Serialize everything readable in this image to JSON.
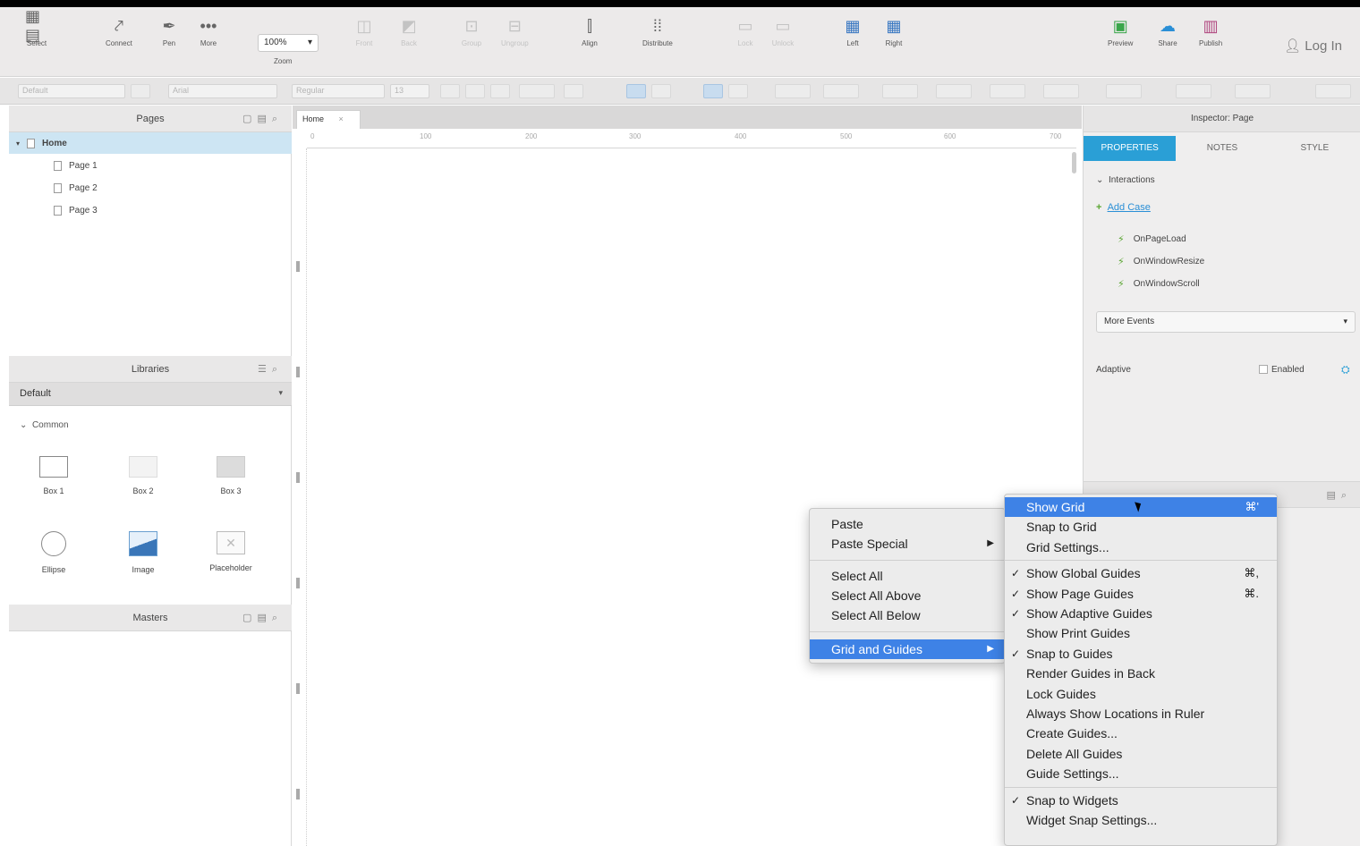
{
  "toolbar": {
    "select_label": "Select",
    "connect_label": "Connect",
    "pen_label": "Pen",
    "more_label": "More",
    "zoom_value": "100%",
    "zoom_label": "Zoom",
    "front_label": "Front",
    "back_label": "Back",
    "group_label": "Group",
    "ungroup_label": "Ungroup",
    "align_label": "Align",
    "distribute_label": "Distribute",
    "lock_label": "Lock",
    "unlock_label": "Unlock",
    "left_label": "Left",
    "right_label": "Right",
    "preview_label": "Preview",
    "share_label": "Share",
    "publish_label": "Publish",
    "login_label": "Log In"
  },
  "format_bar": {
    "style_value": "Default",
    "font_value": "Arial",
    "weight_value": "Regular",
    "size_value": "13"
  },
  "pages_panel": {
    "title": "Pages",
    "home": "Home",
    "items": [
      "Page 1",
      "Page 2",
      "Page 3"
    ]
  },
  "libraries_panel": {
    "title": "Libraries",
    "library": "Default",
    "group": "Common",
    "widgets": [
      "Box 1",
      "Box 2",
      "Box 3",
      "Ellipse",
      "Image",
      "Placeholder"
    ]
  },
  "masters_panel": {
    "title": "Masters"
  },
  "canvas": {
    "tab_label": "Home",
    "ruler_ticks": [
      "0",
      "100",
      "200",
      "300",
      "400",
      "500",
      "600",
      "700"
    ]
  },
  "inspector": {
    "title": "Inspector: Page",
    "tabs": [
      "PROPERTIES",
      "NOTES",
      "STYLE"
    ],
    "interactions_label": "Interactions",
    "add_case_label": "Add Case",
    "events": [
      "OnPageLoad",
      "OnWindowResize",
      "OnWindowScroll"
    ],
    "more_events_label": "More Events",
    "adaptive_label": "Adaptive",
    "enabled_label": "Enabled"
  },
  "context_menu": {
    "items": [
      "Paste",
      "Paste Special",
      "Select All",
      "Select All Above",
      "Select All Below",
      "Grid and Guides"
    ]
  },
  "submenu": {
    "items": [
      {
        "label": "Show Grid",
        "checked": false,
        "shortcut": "⌘'",
        "highlighted": true
      },
      {
        "label": "Snap to Grid",
        "checked": false,
        "shortcut": "",
        "highlighted": false
      },
      {
        "label": "Grid Settings...",
        "checked": false,
        "shortcut": "",
        "highlighted": false
      },
      {
        "label": "Show Global Guides",
        "checked": true,
        "shortcut": "⌘,",
        "highlighted": false
      },
      {
        "label": "Show Page Guides",
        "checked": true,
        "shortcut": "⌘.",
        "highlighted": false
      },
      {
        "label": "Show Adaptive Guides",
        "checked": true,
        "shortcut": "",
        "highlighted": false
      },
      {
        "label": "Show Print Guides",
        "checked": false,
        "shortcut": "",
        "highlighted": false
      },
      {
        "label": "Snap to Guides",
        "checked": true,
        "shortcut": "",
        "highlighted": false
      },
      {
        "label": "Render Guides in Back",
        "checked": false,
        "shortcut": "",
        "highlighted": false
      },
      {
        "label": "Lock Guides",
        "checked": false,
        "shortcut": "",
        "highlighted": false
      },
      {
        "label": "Always Show Locations in Ruler",
        "checked": false,
        "shortcut": "",
        "highlighted": false
      },
      {
        "label": "Create Guides...",
        "checked": false,
        "shortcut": "",
        "highlighted": false
      },
      {
        "label": "Delete All Guides",
        "checked": false,
        "shortcut": "",
        "highlighted": false
      },
      {
        "label": "Guide Settings...",
        "checked": false,
        "shortcut": "",
        "highlighted": false
      },
      {
        "label": "Snap to Widgets",
        "checked": true,
        "shortcut": "",
        "highlighted": false
      },
      {
        "label": "Widget Snap Settings...",
        "checked": false,
        "shortcut": "",
        "highlighted": false
      }
    ]
  },
  "colors": {
    "accent": "#2a9fd6",
    "menu_highlight": "#3e82e6",
    "selection": "#cde5f3",
    "event_icon": "#5aa632"
  }
}
